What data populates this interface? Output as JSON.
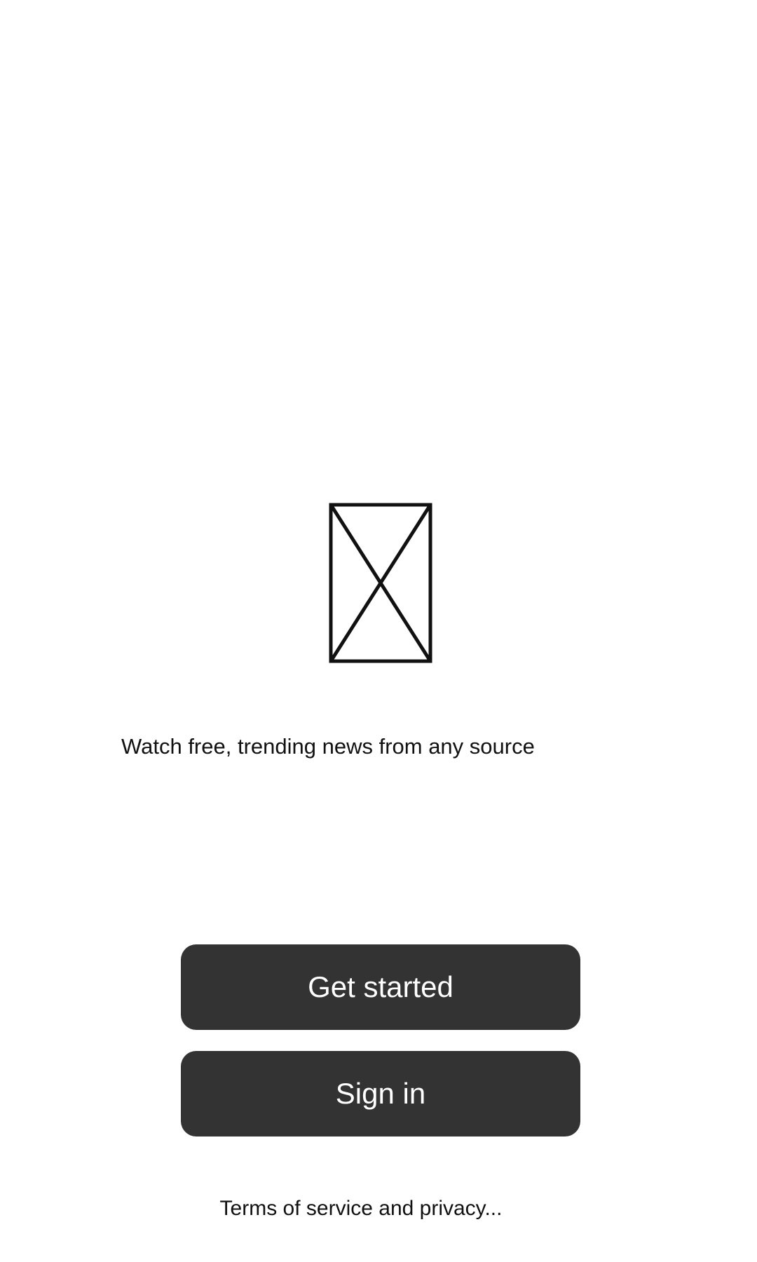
{
  "hero": {
    "image_icon": "image-placeholder-icon",
    "tagline": "Watch free, trending news from any source"
  },
  "actions": {
    "get_started_label": "Get started",
    "sign_in_label": "Sign in"
  },
  "footer": {
    "terms_label": "Terms of service and privacy..."
  },
  "colors": {
    "button_bg": "#333333",
    "button_text": "#ffffff",
    "text": "#111111",
    "background": "#ffffff"
  }
}
